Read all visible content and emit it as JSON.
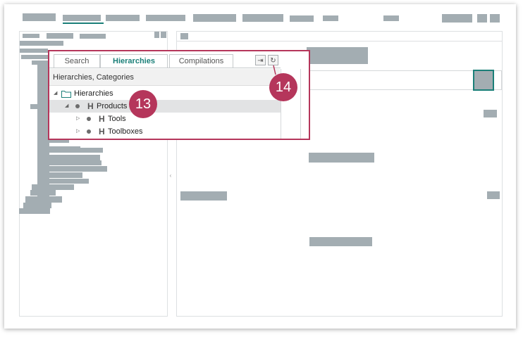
{
  "callout": {
    "tabs": [
      {
        "label": "Search",
        "active": false
      },
      {
        "label": "Hierarchies",
        "active": true
      },
      {
        "label": "Compilations",
        "active": false
      }
    ],
    "breadcrumb": "Hierarchies, Categories",
    "tree": [
      {
        "label": "Hierarchies",
        "icon": "folder-icon",
        "level": 0,
        "expanded": true
      },
      {
        "label": "Products",
        "icon": "hierarchy-icon",
        "level": 1,
        "expanded": true,
        "selected": true
      },
      {
        "label": "Tools",
        "icon": "hierarchy-icon",
        "level": 2,
        "expanded": false
      },
      {
        "label": "Toolboxes",
        "icon": "hierarchy-icon",
        "level": 2,
        "expanded": false
      }
    ],
    "toolbar_icons": [
      "export-icon",
      "refresh-icon"
    ]
  },
  "badges": {
    "a": "13",
    "b": "14"
  },
  "colors": {
    "accent": "#1a7f78",
    "callout_border": "#b5365b",
    "placeholder": "#a3adb2"
  }
}
